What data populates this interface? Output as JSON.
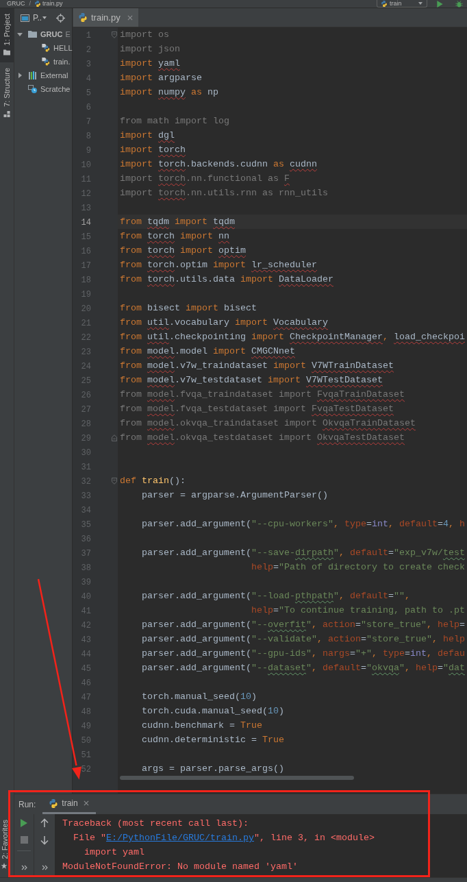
{
  "breadcrumbs": {
    "separator": "/",
    "items": [
      {
        "label": "GRUC",
        "kind": "directory"
      },
      {
        "label": "train.py",
        "kind": "file"
      }
    ]
  },
  "toolbar": {
    "run_config": {
      "label": "train"
    }
  },
  "left_strip": {
    "top": [
      {
        "label": "1: Project",
        "kind": "project",
        "selected": true
      },
      {
        "label": "7: Structure",
        "kind": "structure",
        "selected": false
      }
    ],
    "bottom": [
      {
        "label": "2: Favorites",
        "kind": "favorites",
        "selected": false
      }
    ]
  },
  "project_panel": {
    "title": "P..",
    "tree": [
      {
        "label": "GRUC",
        "detail": "E",
        "kind": "folder",
        "expanded": true,
        "children": [
          {
            "label": "HELL",
            "kind": "python-file"
          },
          {
            "label": "train.",
            "kind": "python-file"
          }
        ]
      },
      {
        "label": "External",
        "kind": "library",
        "expanded": false
      },
      {
        "label": "Scratche",
        "kind": "scratch"
      }
    ]
  },
  "editor": {
    "tabs": [
      {
        "label": "train.py",
        "selected": true
      }
    ],
    "lines": [
      {
        "number": "1",
        "current": false,
        "kind": "fold-start",
        "tokens": [
          {
            "text": "import os",
            "kind": "unused"
          }
        ]
      },
      {
        "number": "2",
        "current": false,
        "kind": "code",
        "tokens": [
          {
            "text": "import json",
            "kind": "unused"
          }
        ]
      },
      {
        "number": "3",
        "current": false,
        "kind": "code",
        "tokens": [
          {
            "text": "import ",
            "kind": "keyword"
          },
          {
            "text": "yaml",
            "kind": "unresolved"
          }
        ]
      },
      {
        "number": "4",
        "current": false,
        "kind": "code",
        "tokens": [
          {
            "text": "import",
            "kind": "keyword"
          },
          {
            "text": " argparse",
            "kind": "plain"
          }
        ]
      },
      {
        "number": "5",
        "current": false,
        "kind": "code",
        "tokens": [
          {
            "text": "import ",
            "kind": "keyword"
          },
          {
            "text": "numpy",
            "kind": "unresolved"
          },
          {
            "text": " as",
            "kind": "keyword"
          },
          {
            "text": " np",
            "kind": "plain"
          }
        ]
      },
      {
        "number": "6",
        "current": false,
        "kind": "code"
      },
      {
        "number": "7",
        "current": false,
        "kind": "code",
        "tokens": [
          {
            "text": "from math import log",
            "kind": "unused"
          }
        ]
      },
      {
        "number": "8",
        "current": false,
        "kind": "code",
        "tokens": [
          {
            "text": "import ",
            "kind": "keyword"
          },
          {
            "text": "dgl",
            "kind": "unresolved"
          }
        ]
      },
      {
        "number": "9",
        "current": false,
        "kind": "code",
        "tokens": [
          {
            "text": "import ",
            "kind": "keyword"
          },
          {
            "text": "torch",
            "kind": "unresolved"
          }
        ]
      },
      {
        "number": "10",
        "current": false,
        "kind": "code",
        "tokens": [
          {
            "text": "import ",
            "kind": "keyword"
          },
          {
            "text": "torch",
            "kind": "unresolved"
          },
          {
            "text": ".backends.cudnn ",
            "kind": "plain"
          },
          {
            "text": "as ",
            "kind": "keyword"
          },
          {
            "text": "cudnn",
            "kind": "unresolved"
          }
        ]
      },
      {
        "number": "11",
        "current": false,
        "kind": "code",
        "tokens": [
          {
            "text": "import ",
            "kind": "unused"
          },
          {
            "text": "torch",
            "kind": "unused-unresolved"
          },
          {
            "text": ".nn.functional as ",
            "kind": "unused"
          },
          {
            "text": "F",
            "kind": "unused-unresolved"
          }
        ]
      },
      {
        "number": "12",
        "current": false,
        "kind": "code",
        "tokens": [
          {
            "text": "import ",
            "kind": "unused"
          },
          {
            "text": "torch",
            "kind": "unused-unresolved"
          },
          {
            "text": ".nn.utils.rnn as rnn_utils",
            "kind": "unused"
          }
        ]
      },
      {
        "number": "13",
        "current": false,
        "kind": "code"
      },
      {
        "number": "14",
        "current": true,
        "kind": "code",
        "tokens": [
          {
            "text": "from ",
            "kind": "keyword"
          },
          {
            "text": "tqdm",
            "kind": "unresolved"
          },
          {
            "text": " import ",
            "kind": "keyword"
          },
          {
            "text": "tqdm",
            "kind": "unresolved"
          }
        ]
      },
      {
        "number": "15",
        "current": false,
        "kind": "code",
        "tokens": [
          {
            "text": "from ",
            "kind": "keyword"
          },
          {
            "text": "torch",
            "kind": "unresolved"
          },
          {
            "text": " import ",
            "kind": "keyword"
          },
          {
            "text": "nn",
            "kind": "unresolved"
          }
        ]
      },
      {
        "number": "16",
        "current": false,
        "kind": "code",
        "tokens": [
          {
            "text": "from ",
            "kind": "keyword"
          },
          {
            "text": "torch",
            "kind": "unresolved"
          },
          {
            "text": " import ",
            "kind": "keyword"
          },
          {
            "text": "optim",
            "kind": "unresolved"
          }
        ]
      },
      {
        "number": "17",
        "current": false,
        "kind": "code",
        "tokens": [
          {
            "text": "from ",
            "kind": "keyword"
          },
          {
            "text": "torch",
            "kind": "unresolved"
          },
          {
            "text": ".optim",
            "kind": "plain"
          },
          {
            "text": " import ",
            "kind": "keyword"
          },
          {
            "text": "lr_scheduler",
            "kind": "unresolved"
          }
        ]
      },
      {
        "number": "18",
        "current": false,
        "kind": "code",
        "tokens": [
          {
            "text": "from ",
            "kind": "keyword"
          },
          {
            "text": "torch",
            "kind": "unresolved"
          },
          {
            "text": ".utils.data",
            "kind": "plain"
          },
          {
            "text": " import ",
            "kind": "keyword"
          },
          {
            "text": "DataLoader",
            "kind": "unresolved"
          }
        ]
      },
      {
        "number": "19",
        "current": false,
        "kind": "code"
      },
      {
        "number": "20",
        "current": false,
        "kind": "code",
        "tokens": [
          {
            "text": "from",
            "kind": "keyword"
          },
          {
            "text": " bisect",
            "kind": "plain"
          },
          {
            "text": " import",
            "kind": "keyword"
          },
          {
            "text": " bisect",
            "kind": "plain"
          }
        ]
      },
      {
        "number": "21",
        "current": false,
        "kind": "code",
        "tokens": [
          {
            "text": "from ",
            "kind": "keyword"
          },
          {
            "text": "util",
            "kind": "unresolved"
          },
          {
            "text": ".vocabulary",
            "kind": "plain"
          },
          {
            "text": " import ",
            "kind": "keyword"
          },
          {
            "text": "Vocabulary",
            "kind": "unresolved"
          }
        ]
      },
      {
        "number": "22",
        "current": false,
        "kind": "code",
        "tokens": [
          {
            "text": "from ",
            "kind": "keyword"
          },
          {
            "text": "util",
            "kind": "unresolved"
          },
          {
            "text": ".checkpointing",
            "kind": "plain"
          },
          {
            "text": " import ",
            "kind": "keyword"
          },
          {
            "text": "CheckpointManager",
            "kind": "unresolved"
          },
          {
            "text": ", ",
            "kind": "comma"
          },
          {
            "text": "load_checkpoi",
            "kind": "unresolved"
          }
        ]
      },
      {
        "number": "23",
        "current": false,
        "kind": "code",
        "tokens": [
          {
            "text": "from ",
            "kind": "keyword"
          },
          {
            "text": "model",
            "kind": "unresolved"
          },
          {
            "text": ".model",
            "kind": "plain"
          },
          {
            "text": " import ",
            "kind": "keyword"
          },
          {
            "text": "CMGCNnet",
            "kind": "unresolved"
          }
        ]
      },
      {
        "number": "24",
        "current": false,
        "kind": "code",
        "tokens": [
          {
            "text": "from ",
            "kind": "keyword"
          },
          {
            "text": "model",
            "kind": "unresolved"
          },
          {
            "text": ".v7w_traindataset",
            "kind": "plain"
          },
          {
            "text": " import ",
            "kind": "keyword"
          },
          {
            "text": "V7WTrainDataset",
            "kind": "unresolved"
          }
        ]
      },
      {
        "number": "25",
        "current": false,
        "kind": "code",
        "tokens": [
          {
            "text": "from ",
            "kind": "keyword"
          },
          {
            "text": "model",
            "kind": "unresolved"
          },
          {
            "text": ".v7w_testdataset",
            "kind": "plain"
          },
          {
            "text": " import ",
            "kind": "keyword"
          },
          {
            "text": "V7WTestDataset",
            "kind": "unresolved"
          }
        ]
      },
      {
        "number": "26",
        "current": false,
        "kind": "code",
        "tokens": [
          {
            "text": "from ",
            "kind": "unused"
          },
          {
            "text": "model",
            "kind": "unused-unresolved"
          },
          {
            "text": ".fvqa_traindataset import ",
            "kind": "unused"
          },
          {
            "text": "FvqaTrainDataset",
            "kind": "unused-unresolved"
          }
        ]
      },
      {
        "number": "27",
        "current": false,
        "kind": "code",
        "tokens": [
          {
            "text": "from ",
            "kind": "unused"
          },
          {
            "text": "model",
            "kind": "unused-unresolved"
          },
          {
            "text": ".fvqa_testdataset import ",
            "kind": "unused"
          },
          {
            "text": "FvqaTestDataset",
            "kind": "unused-unresolved"
          }
        ]
      },
      {
        "number": "28",
        "current": false,
        "kind": "code",
        "tokens": [
          {
            "text": "from ",
            "kind": "unused"
          },
          {
            "text": "model",
            "kind": "unused-unresolved"
          },
          {
            "text": ".okvqa_traindataset import ",
            "kind": "unused"
          },
          {
            "text": "OkvqaTrainDataset",
            "kind": "unused-unresolved"
          }
        ]
      },
      {
        "number": "29",
        "current": false,
        "kind": "fold-end",
        "tokens": [
          {
            "text": "from ",
            "kind": "unused"
          },
          {
            "text": "model",
            "kind": "unused-unresolved"
          },
          {
            "text": ".okvqa_testdataset import ",
            "kind": "unused"
          },
          {
            "text": "OkvqaTestDataset",
            "kind": "unused-unresolved"
          }
        ]
      },
      {
        "number": "30",
        "current": false,
        "kind": "code"
      },
      {
        "number": "31",
        "current": false,
        "kind": "code"
      },
      {
        "number": "32",
        "current": false,
        "kind": "fold-start",
        "tokens": [
          {
            "text": "def ",
            "kind": "keyword"
          },
          {
            "text": "train",
            "kind": "function"
          },
          {
            "text": "():",
            "kind": "plain"
          }
        ]
      },
      {
        "number": "33",
        "current": false,
        "kind": "code",
        "tokens": [
          {
            "text": "    parser = argparse.ArgumentParser()",
            "kind": "plain"
          }
        ]
      },
      {
        "number": "34",
        "current": false,
        "kind": "code"
      },
      {
        "number": "35",
        "current": false,
        "kind": "code",
        "tokens": [
          {
            "text": "    parser.add_argument(",
            "kind": "plain"
          },
          {
            "text": "\"--cpu-workers\"",
            "kind": "string"
          },
          {
            "text": ", ",
            "kind": "comma"
          },
          {
            "text": "type",
            "kind": "param"
          },
          {
            "text": "=",
            "kind": "plain"
          },
          {
            "text": "int",
            "kind": "builtin"
          },
          {
            "text": ", ",
            "kind": "comma"
          },
          {
            "text": "default",
            "kind": "param"
          },
          {
            "text": "=",
            "kind": "plain"
          },
          {
            "text": "4",
            "kind": "number"
          },
          {
            "text": ", ",
            "kind": "comma"
          },
          {
            "text": "h",
            "kind": "param"
          }
        ]
      },
      {
        "number": "36",
        "current": false,
        "kind": "code"
      },
      {
        "number": "37",
        "current": false,
        "kind": "code",
        "tokens": [
          {
            "text": "    parser.add_argument(",
            "kind": "plain"
          },
          {
            "text": "\"--save-",
            "kind": "string"
          },
          {
            "text": "dirpath",
            "kind": "misspelled"
          },
          {
            "text": "\"",
            "kind": "string"
          },
          {
            "text": ", ",
            "kind": "comma"
          },
          {
            "text": "default",
            "kind": "param"
          },
          {
            "text": "=",
            "kind": "plain"
          },
          {
            "text": "\"exp_v7w/",
            "kind": "string"
          },
          {
            "text": "test",
            "kind": "misspelled"
          }
        ]
      },
      {
        "number": "38",
        "current": false,
        "kind": "code",
        "tokens": [
          {
            "text": "                        help",
            "kind": "param"
          },
          {
            "text": "=",
            "kind": "plain"
          },
          {
            "text": "\"Path of directory to create check",
            "kind": "string"
          }
        ]
      },
      {
        "number": "39",
        "current": false,
        "kind": "code"
      },
      {
        "number": "40",
        "current": false,
        "kind": "code",
        "tokens": [
          {
            "text": "    parser.add_argument(",
            "kind": "plain"
          },
          {
            "text": "\"--load-",
            "kind": "string"
          },
          {
            "text": "pthpath",
            "kind": "misspelled"
          },
          {
            "text": "\"",
            "kind": "string"
          },
          {
            "text": ", ",
            "kind": "comma"
          },
          {
            "text": "default",
            "kind": "param"
          },
          {
            "text": "=",
            "kind": "plain"
          },
          {
            "text": "\"\"",
            "kind": "string"
          },
          {
            "text": ",",
            "kind": "comma"
          }
        ]
      },
      {
        "number": "41",
        "current": false,
        "kind": "code",
        "tokens": [
          {
            "text": "                        help",
            "kind": "param"
          },
          {
            "text": "=",
            "kind": "plain"
          },
          {
            "text": "\"To continue training, path to .pt",
            "kind": "string"
          }
        ]
      },
      {
        "number": "42",
        "current": false,
        "kind": "code",
        "tokens": [
          {
            "text": "    parser.add_argument(",
            "kind": "plain"
          },
          {
            "text": "\"--",
            "kind": "string"
          },
          {
            "text": "overfit",
            "kind": "misspelled"
          },
          {
            "text": "\"",
            "kind": "string"
          },
          {
            "text": ", ",
            "kind": "comma"
          },
          {
            "text": "action",
            "kind": "param"
          },
          {
            "text": "=",
            "kind": "plain"
          },
          {
            "text": "\"store_true\"",
            "kind": "string"
          },
          {
            "text": ", ",
            "kind": "comma"
          },
          {
            "text": "help",
            "kind": "param"
          },
          {
            "text": "=",
            "kind": "plain"
          }
        ]
      },
      {
        "number": "43",
        "current": false,
        "kind": "code",
        "tokens": [
          {
            "text": "    parser.add_argument(",
            "kind": "plain"
          },
          {
            "text": "\"--validate\"",
            "kind": "string"
          },
          {
            "text": ", ",
            "kind": "comma"
          },
          {
            "text": "action",
            "kind": "param"
          },
          {
            "text": "=",
            "kind": "plain"
          },
          {
            "text": "\"store_true\"",
            "kind": "string"
          },
          {
            "text": ", ",
            "kind": "comma"
          },
          {
            "text": "help",
            "kind": "param"
          }
        ]
      },
      {
        "number": "44",
        "current": false,
        "kind": "code",
        "tokens": [
          {
            "text": "    parser.add_argument(",
            "kind": "plain"
          },
          {
            "text": "\"--gpu-ids\"",
            "kind": "string"
          },
          {
            "text": ", ",
            "kind": "comma"
          },
          {
            "text": "nargs",
            "kind": "param"
          },
          {
            "text": "=",
            "kind": "plain"
          },
          {
            "text": "\"+\"",
            "kind": "string"
          },
          {
            "text": ", ",
            "kind": "comma"
          },
          {
            "text": "type",
            "kind": "param"
          },
          {
            "text": "=",
            "kind": "plain"
          },
          {
            "text": "int",
            "kind": "builtin"
          },
          {
            "text": ", ",
            "kind": "comma"
          },
          {
            "text": "defau",
            "kind": "param"
          }
        ]
      },
      {
        "number": "45",
        "current": false,
        "kind": "code",
        "tokens": [
          {
            "text": "    parser.add_argument(",
            "kind": "plain"
          },
          {
            "text": "\"--",
            "kind": "string"
          },
          {
            "text": "dataset",
            "kind": "misspelled"
          },
          {
            "text": "\"",
            "kind": "string"
          },
          {
            "text": ", ",
            "kind": "comma"
          },
          {
            "text": "default",
            "kind": "param"
          },
          {
            "text": "=",
            "kind": "plain"
          },
          {
            "text": "\"",
            "kind": "string"
          },
          {
            "text": "okvqa",
            "kind": "misspelled"
          },
          {
            "text": "\"",
            "kind": "string"
          },
          {
            "text": ", ",
            "kind": "comma"
          },
          {
            "text": "help",
            "kind": "param"
          },
          {
            "text": "=",
            "kind": "plain"
          },
          {
            "text": "\"",
            "kind": "string"
          },
          {
            "text": "dat",
            "kind": "misspelled"
          }
        ]
      },
      {
        "number": "46",
        "current": false,
        "kind": "code"
      },
      {
        "number": "47",
        "current": false,
        "kind": "code",
        "tokens": [
          {
            "text": "    torch.manual_seed(",
            "kind": "plain"
          },
          {
            "text": "10",
            "kind": "number"
          },
          {
            "text": ")",
            "kind": "plain"
          }
        ]
      },
      {
        "number": "48",
        "current": false,
        "kind": "code",
        "tokens": [
          {
            "text": "    torch.cuda.manual_seed(",
            "kind": "plain"
          },
          {
            "text": "10",
            "kind": "number"
          },
          {
            "text": ")",
            "kind": "plain"
          }
        ]
      },
      {
        "number": "49",
        "current": false,
        "kind": "code",
        "tokens": [
          {
            "text": "    cudnn.benchmark = ",
            "kind": "plain"
          },
          {
            "text": "True",
            "kind": "keyword"
          }
        ]
      },
      {
        "number": "50",
        "current": false,
        "kind": "code",
        "tokens": [
          {
            "text": "    cudnn.deterministic = ",
            "kind": "plain"
          },
          {
            "text": "True",
            "kind": "keyword"
          }
        ]
      },
      {
        "number": "51",
        "current": false,
        "kind": "code"
      },
      {
        "number": "52",
        "current": false,
        "kind": "code",
        "tokens": [
          {
            "text": "    args = parser.parse_args()",
            "kind": "plain"
          }
        ]
      }
    ]
  },
  "run_panel": {
    "label": "Run:",
    "tabs": [
      {
        "label": "train",
        "selected": true
      }
    ],
    "console": [
      {
        "kind": "error",
        "segments": [
          {
            "text": "Traceback (most recent call last):",
            "kind": "text"
          }
        ]
      },
      {
        "kind": "error",
        "segments": [
          {
            "text": "  File \"",
            "kind": "text"
          },
          {
            "text": "E:/PythonFile/GRUC/train.py",
            "kind": "link"
          },
          {
            "text": "\", line 3, in <module>",
            "kind": "text"
          }
        ]
      },
      {
        "kind": "error",
        "segments": [
          {
            "text": "    import yaml",
            "kind": "text"
          }
        ]
      },
      {
        "kind": "error",
        "segments": [
          {
            "text": "ModuleNotFoundError: No module named 'yaml'",
            "kind": "text"
          }
        ]
      }
    ]
  }
}
